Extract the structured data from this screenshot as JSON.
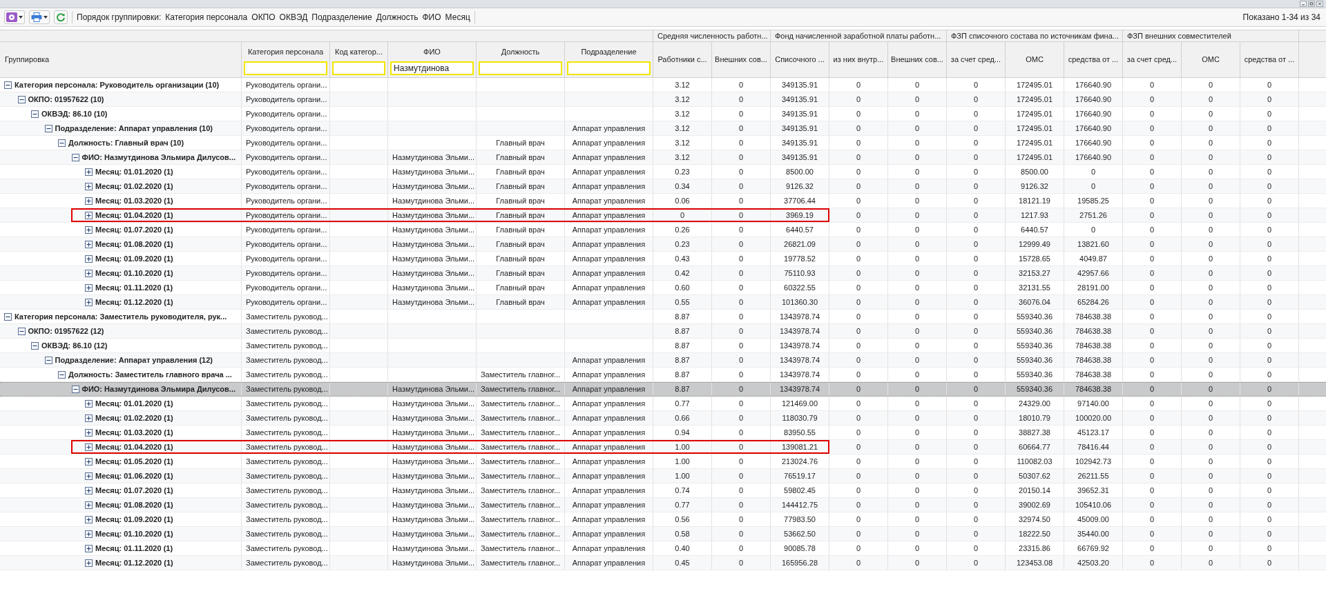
{
  "toolbar": {
    "grouping_label": "Порядок группировки:",
    "grouping_fields": [
      "Категория персонала",
      "ОКПО",
      "ОКВЭД",
      "Подразделение",
      "Должность",
      "ФИО",
      "Месяц"
    ],
    "shown": "Показано 1-34 из 34"
  },
  "table": {
    "grouping_header": "Группировка",
    "text_columns": [
      {
        "label": "Категория персонала"
      },
      {
        "label": "Код категор..."
      },
      {
        "label": "ФИО",
        "filter": "Назмутдинова"
      },
      {
        "label": "Должность"
      },
      {
        "label": "Подразделение"
      }
    ],
    "value_groups": [
      {
        "label": "Средняя численность работн...",
        "columns": [
          "Работники с...",
          "Внешних сов..."
        ]
      },
      {
        "label": "Фонд начисленной заработной платы работн...",
        "columns": [
          "Списочного ...",
          "из них внутр...",
          "Внешних сов..."
        ]
      },
      {
        "label": "ФЗП списочного состава по источникам фина...",
        "columns": [
          "за счет сред...",
          "ОМС",
          "средства от ..."
        ]
      },
      {
        "label": "ФЗП внешних совместителей",
        "columns": [
          "за счет сред...",
          "ОМС",
          "средства от ..."
        ]
      }
    ],
    "rows": [
      {
        "label": "Категория персонала: Руководитель организации (10)",
        "expanded": true,
        "selected": false,
        "outlined": false,
        "cells": [
          "Руководитель органи...",
          null,
          null,
          null,
          null
        ],
        "values": [
          "3.12",
          "0",
          "349135.91",
          "0",
          "0",
          "0",
          "172495.01",
          "176640.90",
          "0",
          "0",
          "0"
        ],
        "children": [
          {
            "label": "ОКПО: 01957622 (10)",
            "expanded": true,
            "selected": false,
            "outlined": false,
            "cells": [
              "Руководитель органи...",
              null,
              null,
              null,
              null
            ],
            "values": [
              "3.12",
              "0",
              "349135.91",
              "0",
              "0",
              "0",
              "172495.01",
              "176640.90",
              "0",
              "0",
              "0"
            ],
            "children": [
              {
                "label": "ОКВЭД: 86.10 (10)",
                "expanded": true,
                "selected": false,
                "outlined": false,
                "cells": [
                  "Руководитель органи...",
                  null,
                  null,
                  null,
                  null
                ],
                "values": [
                  "3.12",
                  "0",
                  "349135.91",
                  "0",
                  "0",
                  "0",
                  "172495.01",
                  "176640.90",
                  "0",
                  "0",
                  "0"
                ],
                "children": [
                  {
                    "label": "Подразделение: Аппарат управления (10)",
                    "expanded": true,
                    "selected": false,
                    "outlined": false,
                    "cells": [
                      "Руководитель органи...",
                      null,
                      null,
                      null,
                      "Аппарат управления"
                    ],
                    "values": [
                      "3.12",
                      "0",
                      "349135.91",
                      "0",
                      "0",
                      "0",
                      "172495.01",
                      "176640.90",
                      "0",
                      "0",
                      "0"
                    ],
                    "children": [
                      {
                        "label": "Должность: Главный врач (10)",
                        "expanded": true,
                        "selected": false,
                        "outlined": false,
                        "cells": [
                          "Руководитель органи...",
                          null,
                          null,
                          "Главный врач",
                          "Аппарат управления"
                        ],
                        "values": [
                          "3.12",
                          "0",
                          "349135.91",
                          "0",
                          "0",
                          "0",
                          "172495.01",
                          "176640.90",
                          "0",
                          "0",
                          "0"
                        ],
                        "children": [
                          {
                            "label": "ФИО: Назмутдинова Эльмира Дилусов...",
                            "expanded": true,
                            "selected": false,
                            "outlined": false,
                            "cells": [
                              "Руководитель органи...",
                              null,
                              "Назмутдинова Эльми...",
                              "Главный врач",
                              "Аппарат управления"
                            ],
                            "values": [
                              "3.12",
                              "0",
                              "349135.91",
                              "0",
                              "0",
                              "0",
                              "172495.01",
                              "176640.90",
                              "0",
                              "0",
                              "0"
                            ],
                            "children": [
                              {
                                "label": "Месяц: 01.01.2020 (1)",
                                "expanded": false,
                                "selected": false,
                                "outlined": false,
                                "cells": [
                                  "Руководитель органи...",
                                  null,
                                  "Назмутдинова Эльми...",
                                  "Главный врач",
                                  "Аппарат управления"
                                ],
                                "values": [
                                  "0.23",
                                  "0",
                                  "8500.00",
                                  "0",
                                  "0",
                                  "0",
                                  "8500.00",
                                  "0",
                                  "0",
                                  "0",
                                  "0"
                                ]
                              },
                              {
                                "label": "Месяц: 01.02.2020 (1)",
                                "expanded": false,
                                "selected": false,
                                "outlined": false,
                                "cells": [
                                  "Руководитель органи...",
                                  null,
                                  "Назмутдинова Эльми...",
                                  "Главный врач",
                                  "Аппарат управления"
                                ],
                                "values": [
                                  "0.34",
                                  "0",
                                  "9126.32",
                                  "0",
                                  "0",
                                  "0",
                                  "9126.32",
                                  "0",
                                  "0",
                                  "0",
                                  "0"
                                ]
                              },
                              {
                                "label": "Месяц: 01.03.2020 (1)",
                                "expanded": false,
                                "selected": false,
                                "outlined": false,
                                "cells": [
                                  "Руководитель органи...",
                                  null,
                                  "Назмутдинова Эльми...",
                                  "Главный врач",
                                  "Аппарат управления"
                                ],
                                "values": [
                                  "0.06",
                                  "0",
                                  "37706.44",
                                  "0",
                                  "0",
                                  "0",
                                  "18121.19",
                                  "19585.25",
                                  "0",
                                  "0",
                                  "0"
                                ]
                              },
                              {
                                "label": "Месяц: 01.04.2020 (1)",
                                "expanded": false,
                                "selected": false,
                                "outlined": true,
                                "cells": [
                                  "Руководитель органи...",
                                  null,
                                  "Назмутдинова Эльми...",
                                  "Главный врач",
                                  "Аппарат управления"
                                ],
                                "values": [
                                  "0",
                                  "0",
                                  "3969.19",
                                  "0",
                                  "0",
                                  "0",
                                  "1217.93",
                                  "2751.26",
                                  "0",
                                  "0",
                                  "0"
                                ]
                              },
                              {
                                "label": "Месяц: 01.07.2020 (1)",
                                "expanded": false,
                                "selected": false,
                                "outlined": false,
                                "cells": [
                                  "Руководитель органи...",
                                  null,
                                  "Назмутдинова Эльми...",
                                  "Главный врач",
                                  "Аппарат управления"
                                ],
                                "values": [
                                  "0.26",
                                  "0",
                                  "6440.57",
                                  "0",
                                  "0",
                                  "0",
                                  "6440.57",
                                  "0",
                                  "0",
                                  "0",
                                  "0"
                                ]
                              },
                              {
                                "label": "Месяц: 01.08.2020 (1)",
                                "expanded": false,
                                "selected": false,
                                "outlined": false,
                                "cells": [
                                  "Руководитель органи...",
                                  null,
                                  "Назмутдинова Эльми...",
                                  "Главный врач",
                                  "Аппарат управления"
                                ],
                                "values": [
                                  "0.23",
                                  "0",
                                  "26821.09",
                                  "0",
                                  "0",
                                  "0",
                                  "12999.49",
                                  "13821.60",
                                  "0",
                                  "0",
                                  "0"
                                ]
                              },
                              {
                                "label": "Месяц: 01.09.2020 (1)",
                                "expanded": false,
                                "selected": false,
                                "outlined": false,
                                "cells": [
                                  "Руководитель органи...",
                                  null,
                                  "Назмутдинова Эльми...",
                                  "Главный врач",
                                  "Аппарат управления"
                                ],
                                "values": [
                                  "0.43",
                                  "0",
                                  "19778.52",
                                  "0",
                                  "0",
                                  "0",
                                  "15728.65",
                                  "4049.87",
                                  "0",
                                  "0",
                                  "0"
                                ]
                              },
                              {
                                "label": "Месяц: 01.10.2020 (1)",
                                "expanded": false,
                                "selected": false,
                                "outlined": false,
                                "cells": [
                                  "Руководитель органи...",
                                  null,
                                  "Назмутдинова Эльми...",
                                  "Главный врач",
                                  "Аппарат управления"
                                ],
                                "values": [
                                  "0.42",
                                  "0",
                                  "75110.93",
                                  "0",
                                  "0",
                                  "0",
                                  "32153.27",
                                  "42957.66",
                                  "0",
                                  "0",
                                  "0"
                                ]
                              },
                              {
                                "label": "Месяц: 01.11.2020 (1)",
                                "expanded": false,
                                "selected": false,
                                "outlined": false,
                                "cells": [
                                  "Руководитель органи...",
                                  null,
                                  "Назмутдинова Эльми...",
                                  "Главный врач",
                                  "Аппарат управления"
                                ],
                                "values": [
                                  "0.60",
                                  "0",
                                  "60322.55",
                                  "0",
                                  "0",
                                  "0",
                                  "32131.55",
                                  "28191.00",
                                  "0",
                                  "0",
                                  "0"
                                ]
                              },
                              {
                                "label": "Месяц: 01.12.2020 (1)",
                                "expanded": false,
                                "selected": false,
                                "outlined": false,
                                "cells": [
                                  "Руководитель органи...",
                                  null,
                                  "Назмутдинова Эльми...",
                                  "Главный врач",
                                  "Аппарат управления"
                                ],
                                "values": [
                                  "0.55",
                                  "0",
                                  "101360.30",
                                  "0",
                                  "0",
                                  "0",
                                  "36076.04",
                                  "65284.26",
                                  "0",
                                  "0",
                                  "0"
                                ]
                              }
                            ]
                          }
                        ]
                      }
                    ]
                  }
                ]
              }
            ]
          }
        ]
      },
      {
        "label": "Категория персонала: Заместитель руководителя, рук...",
        "expanded": true,
        "selected": false,
        "outlined": false,
        "cells": [
          "Заместитель руковод...",
          null,
          null,
          null,
          null
        ],
        "values": [
          "8.87",
          "0",
          "1343978.74",
          "0",
          "0",
          "0",
          "559340.36",
          "784638.38",
          "0",
          "0",
          "0"
        ],
        "children": [
          {
            "label": "ОКПО: 01957622 (12)",
            "expanded": true,
            "selected": false,
            "outlined": false,
            "cells": [
              "Заместитель руковод...",
              null,
              null,
              null,
              null
            ],
            "values": [
              "8.87",
              "0",
              "1343978.74",
              "0",
              "0",
              "0",
              "559340.36",
              "784638.38",
              "0",
              "0",
              "0"
            ],
            "children": [
              {
                "label": "ОКВЭД: 86.10 (12)",
                "expanded": true,
                "selected": false,
                "outlined": false,
                "cells": [
                  "Заместитель руковод...",
                  null,
                  null,
                  null,
                  null
                ],
                "values": [
                  "8.87",
                  "0",
                  "1343978.74",
                  "0",
                  "0",
                  "0",
                  "559340.36",
                  "784638.38",
                  "0",
                  "0",
                  "0"
                ],
                "children": [
                  {
                    "label": "Подразделение: Аппарат управления (12)",
                    "expanded": true,
                    "selected": false,
                    "outlined": false,
                    "cells": [
                      "Заместитель руковод...",
                      null,
                      null,
                      null,
                      "Аппарат управления"
                    ],
                    "values": [
                      "8.87",
                      "0",
                      "1343978.74",
                      "0",
                      "0",
                      "0",
                      "559340.36",
                      "784638.38",
                      "0",
                      "0",
                      "0"
                    ],
                    "children": [
                      {
                        "label": "Должность: Заместитель главного врача ...",
                        "expanded": true,
                        "selected": false,
                        "outlined": false,
                        "cells": [
                          "Заместитель руковод...",
                          null,
                          null,
                          "Заместитель главног...",
                          "Аппарат управления"
                        ],
                        "values": [
                          "8.87",
                          "0",
                          "1343978.74",
                          "0",
                          "0",
                          "0",
                          "559340.36",
                          "784638.38",
                          "0",
                          "0",
                          "0"
                        ],
                        "children": [
                          {
                            "label": "ФИО: Назмутдинова Эльмира Дилусов...",
                            "expanded": true,
                            "selected": true,
                            "outlined": false,
                            "cells": [
                              "Заместитель руковод...",
                              null,
                              "Назмутдинова Эльми...",
                              "Заместитель главног...",
                              "Аппарат управления"
                            ],
                            "values": [
                              "8.87",
                              "0",
                              "1343978.74",
                              "0",
                              "0",
                              "0",
                              "559340.36",
                              "784638.38",
                              "0",
                              "0",
                              "0"
                            ],
                            "children": [
                              {
                                "label": "Месяц: 01.01.2020 (1)",
                                "expanded": false,
                                "selected": false,
                                "outlined": false,
                                "cells": [
                                  "Заместитель руковод...",
                                  null,
                                  "Назмутдинова Эльми...",
                                  "Заместитель главног...",
                                  "Аппарат управления"
                                ],
                                "values": [
                                  "0.77",
                                  "0",
                                  "121469.00",
                                  "0",
                                  "0",
                                  "0",
                                  "24329.00",
                                  "97140.00",
                                  "0",
                                  "0",
                                  "0"
                                ]
                              },
                              {
                                "label": "Месяц: 01.02.2020 (1)",
                                "expanded": false,
                                "selected": false,
                                "outlined": false,
                                "cells": [
                                  "Заместитель руковод...",
                                  null,
                                  "Назмутдинова Эльми...",
                                  "Заместитель главног...",
                                  "Аппарат управления"
                                ],
                                "values": [
                                  "0.66",
                                  "0",
                                  "118030.79",
                                  "0",
                                  "0",
                                  "0",
                                  "18010.79",
                                  "100020.00",
                                  "0",
                                  "0",
                                  "0"
                                ]
                              },
                              {
                                "label": "Месяц: 01.03.2020 (1)",
                                "expanded": false,
                                "selected": false,
                                "outlined": false,
                                "cells": [
                                  "Заместитель руковод...",
                                  null,
                                  "Назмутдинова Эльми...",
                                  "Заместитель главног...",
                                  "Аппарат управления"
                                ],
                                "values": [
                                  "0.94",
                                  "0",
                                  "83950.55",
                                  "0",
                                  "0",
                                  "0",
                                  "38827.38",
                                  "45123.17",
                                  "0",
                                  "0",
                                  "0"
                                ]
                              },
                              {
                                "label": "Месяц: 01.04.2020 (1)",
                                "expanded": false,
                                "selected": false,
                                "outlined": true,
                                "cells": [
                                  "Заместитель руковод...",
                                  null,
                                  "Назмутдинова Эльми...",
                                  "Заместитель главног...",
                                  "Аппарат управления"
                                ],
                                "values": [
                                  "1.00",
                                  "0",
                                  "139081.21",
                                  "0",
                                  "0",
                                  "0",
                                  "60664.77",
                                  "78416.44",
                                  "0",
                                  "0",
                                  "0"
                                ]
                              },
                              {
                                "label": "Месяц: 01.05.2020 (1)",
                                "expanded": false,
                                "selected": false,
                                "outlined": false,
                                "cells": [
                                  "Заместитель руковод...",
                                  null,
                                  "Назмутдинова Эльми...",
                                  "Заместитель главног...",
                                  "Аппарат управления"
                                ],
                                "values": [
                                  "1.00",
                                  "0",
                                  "213024.76",
                                  "0",
                                  "0",
                                  "0",
                                  "110082.03",
                                  "102942.73",
                                  "0",
                                  "0",
                                  "0"
                                ]
                              },
                              {
                                "label": "Месяц: 01.06.2020 (1)",
                                "expanded": false,
                                "selected": false,
                                "outlined": false,
                                "cells": [
                                  "Заместитель руковод...",
                                  null,
                                  "Назмутдинова Эльми...",
                                  "Заместитель главног...",
                                  "Аппарат управления"
                                ],
                                "values": [
                                  "1.00",
                                  "0",
                                  "76519.17",
                                  "0",
                                  "0",
                                  "0",
                                  "50307.62",
                                  "26211.55",
                                  "0",
                                  "0",
                                  "0"
                                ]
                              },
                              {
                                "label": "Месяц: 01.07.2020 (1)",
                                "expanded": false,
                                "selected": false,
                                "outlined": false,
                                "cells": [
                                  "Заместитель руковод...",
                                  null,
                                  "Назмутдинова Эльми...",
                                  "Заместитель главног...",
                                  "Аппарат управления"
                                ],
                                "values": [
                                  "0.74",
                                  "0",
                                  "59802.45",
                                  "0",
                                  "0",
                                  "0",
                                  "20150.14",
                                  "39652.31",
                                  "0",
                                  "0",
                                  "0"
                                ]
                              },
                              {
                                "label": "Месяц: 01.08.2020 (1)",
                                "expanded": false,
                                "selected": false,
                                "outlined": false,
                                "cells": [
                                  "Заместитель руковод...",
                                  null,
                                  "Назмутдинова Эльми...",
                                  "Заместитель главног...",
                                  "Аппарат управления"
                                ],
                                "values": [
                                  "0.77",
                                  "0",
                                  "144412.75",
                                  "0",
                                  "0",
                                  "0",
                                  "39002.69",
                                  "105410.06",
                                  "0",
                                  "0",
                                  "0"
                                ]
                              },
                              {
                                "label": "Месяц: 01.09.2020 (1)",
                                "expanded": false,
                                "selected": false,
                                "outlined": false,
                                "cells": [
                                  "Заместитель руковод...",
                                  null,
                                  "Назмутдинова Эльми...",
                                  "Заместитель главног...",
                                  "Аппарат управления"
                                ],
                                "values": [
                                  "0.56",
                                  "0",
                                  "77983.50",
                                  "0",
                                  "0",
                                  "0",
                                  "32974.50",
                                  "45009.00",
                                  "0",
                                  "0",
                                  "0"
                                ]
                              },
                              {
                                "label": "Месяц: 01.10.2020 (1)",
                                "expanded": false,
                                "selected": false,
                                "outlined": false,
                                "cells": [
                                  "Заместитель руковод...",
                                  null,
                                  "Назмутдинова Эльми...",
                                  "Заместитель главног...",
                                  "Аппарат управления"
                                ],
                                "values": [
                                  "0.58",
                                  "0",
                                  "53662.50",
                                  "0",
                                  "0",
                                  "0",
                                  "18222.50",
                                  "35440.00",
                                  "0",
                                  "0",
                                  "0"
                                ]
                              },
                              {
                                "label": "Месяц: 01.11.2020 (1)",
                                "expanded": false,
                                "selected": false,
                                "outlined": false,
                                "cells": [
                                  "Заместитель руковод...",
                                  null,
                                  "Назмутдинова Эльми...",
                                  "Заместитель главног...",
                                  "Аппарат управления"
                                ],
                                "values": [
                                  "0.40",
                                  "0",
                                  "90085.78",
                                  "0",
                                  "0",
                                  "0",
                                  "23315.86",
                                  "66769.92",
                                  "0",
                                  "0",
                                  "0"
                                ]
                              },
                              {
                                "label": "Месяц: 01.12.2020 (1)",
                                "expanded": false,
                                "selected": false,
                                "outlined": false,
                                "cells": [
                                  "Заместитель руковод...",
                                  null,
                                  "Назмутдинова Эльми...",
                                  "Заместитель главног...",
                                  "Аппарат управления"
                                ],
                                "values": [
                                  "0.45",
                                  "0",
                                  "165956.28",
                                  "0",
                                  "0",
                                  "0",
                                  "123453.08",
                                  "42503.20",
                                  "0",
                                  "0",
                                  "0"
                                ]
                              }
                            ]
                          }
                        ]
                      }
                    ]
                  }
                ]
              }
            ]
          }
        ]
      }
    ]
  }
}
